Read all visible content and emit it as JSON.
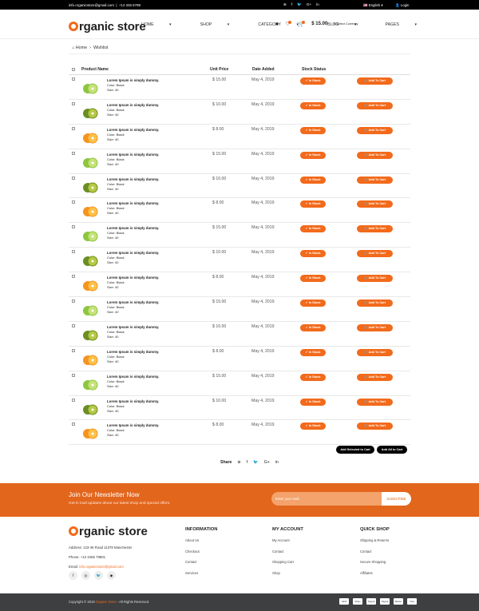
{
  "topbar": {
    "email": "info.organicstore@gmail.com",
    "phone": "+12 345 6789",
    "lang": "English",
    "login": "Login",
    "social": [
      "rss",
      "f",
      "tw",
      "G+",
      "in"
    ]
  },
  "header": {
    "logo_o": "O",
    "logo_rest": "rganic store",
    "nav": [
      "HOME",
      "SHOP",
      "CATEGORY",
      "BLOG",
      "PAGES"
    ],
    "price": "$ 15.00",
    "currency": "Select Currency",
    "cart_count": "0"
  },
  "breadcrumb": {
    "home": "Home",
    "current": "Wishlist"
  },
  "table": {
    "headers": [
      "Product Name",
      "Unit Price",
      "Date Added",
      "Stock Status"
    ],
    "stock_label": "In Stock",
    "cart_label": "Add To Cart",
    "rows": [
      {
        "name": "Lorem Ipsum is simply dummy.",
        "color": "Color: Black",
        "size": "Size: 40",
        "price": "$ 15.00",
        "date": "May 4, 2019",
        "fruit": "lime"
      },
      {
        "name": "Lorem Ipsum is simply dummy.",
        "color": "Color: Black",
        "size": "Size: 40",
        "price": "$ 10.00",
        "date": "May 4, 2019",
        "fruit": "kiwi"
      },
      {
        "name": "Lorem Ipsum is simply dummy.",
        "color": "Color: Black",
        "size": "Size: 40",
        "price": "$ 8.00",
        "date": "May 4, 2019",
        "fruit": "orange"
      },
      {
        "name": "Lorem Ipsum is simply dummy.",
        "color": "Color: Black",
        "size": "Size: 40",
        "price": "$ 15.00",
        "date": "May 4, 2019",
        "fruit": "lime"
      },
      {
        "name": "Lorem Ipsum is simply dummy.",
        "color": "Color: Black",
        "size": "Size: 40",
        "price": "$ 10.00",
        "date": "May 4, 2019",
        "fruit": "kiwi"
      },
      {
        "name": "Lorem Ipsum is simply dummy.",
        "color": "Color: Black",
        "size": "Size: 40",
        "price": "$ 8.00",
        "date": "May 4, 2019",
        "fruit": "orange"
      },
      {
        "name": "Lorem Ipsum is simply dummy.",
        "color": "Color: Black",
        "size": "Size: 40",
        "price": "$ 15.00",
        "date": "May 4, 2019",
        "fruit": "lime"
      },
      {
        "name": "Lorem Ipsum is simply dummy.",
        "color": "Color: Black",
        "size": "Size: 40",
        "price": "$ 10.00",
        "date": "May 4, 2019",
        "fruit": "kiwi"
      },
      {
        "name": "Lorem Ipsum is simply dummy.",
        "color": "Color: Black",
        "size": "Size: 40",
        "price": "$ 8.00",
        "date": "May 4, 2019",
        "fruit": "orange"
      },
      {
        "name": "Lorem Ipsum is simply dummy.",
        "color": "Color: Black",
        "size": "Size: 40",
        "price": "$ 15.00",
        "date": "May 4, 2019",
        "fruit": "lime"
      },
      {
        "name": "Lorem Ipsum is simply dummy.",
        "color": "Color: Black",
        "size": "Size: 40",
        "price": "$ 10.00",
        "date": "May 4, 2019",
        "fruit": "kiwi"
      },
      {
        "name": "Lorem Ipsum is simply dummy.",
        "color": "Color: Black",
        "size": "Size: 40",
        "price": "$ 8.00",
        "date": "May 4, 2019",
        "fruit": "orange"
      },
      {
        "name": "Lorem Ipsum is simply dummy.",
        "color": "Color: Black",
        "size": "Size: 40",
        "price": "$ 15.00",
        "date": "May 4, 2019",
        "fruit": "lime"
      },
      {
        "name": "Lorem Ipsum is simply dummy.",
        "color": "Color: Black",
        "size": "Size: 40",
        "price": "$ 10.00",
        "date": "May 4, 2019",
        "fruit": "kiwi"
      },
      {
        "name": "Lorem Ipsum is simply dummy.",
        "color": "Color: Black",
        "size": "Size: 40",
        "price": "$ 8.00",
        "date": "May 4, 2019",
        "fruit": "orange"
      }
    ]
  },
  "actions": {
    "add_selected": "Add Selected to Cart",
    "add_all": "Add All to Cart"
  },
  "share": {
    "label": "Share",
    "icons": [
      "rss",
      "f",
      "tw",
      "G+",
      "in"
    ]
  },
  "newsletter": {
    "title": "Join Our Newsletter Now",
    "subtitle": "Get E-mail updates about our latest shop and special offers.",
    "placeholder": "Enter your mail",
    "button": "SUBSCRIBE"
  },
  "footer": {
    "logo_o": "O",
    "logo_rest": "rganic store",
    "address": "Address: 123-45 Road 11378 Manchester",
    "phone": "Phone: +12 3456 78901",
    "email_label": "Email: ",
    "email": "info.organicstore@gmail.com",
    "social": [
      "f",
      "ig",
      "tw",
      "dr"
    ],
    "columns": [
      {
        "title": "INFORMATION",
        "links": [
          "About Us",
          "Checkout",
          "Contact",
          "Services"
        ]
      },
      {
        "title": "MY ACCOUNT",
        "links": [
          "My Account",
          "Contact",
          "Shopping Cart",
          "Shop"
        ]
      },
      {
        "title": "QUICK SHOP",
        "links": [
          "Shipping & Returns",
          "Contact",
          "Secure Shopping",
          "Affiliates"
        ]
      }
    ]
  },
  "bottom": {
    "copy_prefix": "Copyright © 2019 ",
    "brand": "Organic Store",
    "copy_suffix": " - All Rights Reserved.",
    "payments": [
      "Skrill",
      "Stripe",
      "Paypal",
      "Paypal",
      "Master",
      "Visa"
    ]
  },
  "colors": {
    "accent": "#f26a1b",
    "newsletter_bg": "#e3661d",
    "footer_bar": "#3d3f41"
  }
}
